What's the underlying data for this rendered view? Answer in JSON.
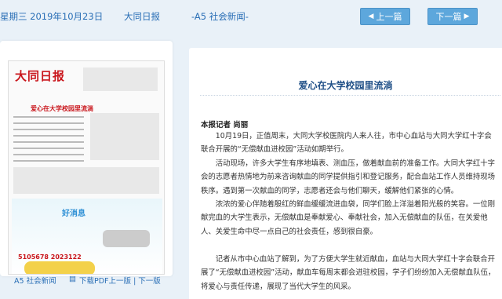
{
  "header": {
    "date": "星期三 2019年10月23日",
    "paper": "大同日报",
    "section": "-A5 社会新闻-",
    "prev_label": "上一篇",
    "next_label": "下一篇"
  },
  "thumbnail": {
    "newspaper_name": "大同日报",
    "headline": "爱心在大学校园里流淌",
    "ad_title": "好消息",
    "phone": "5105678  2023122"
  },
  "footer": {
    "page_label": "A5 社会新闻",
    "pdf_label": "下载PDF",
    "prev_link": "上一版",
    "separator": "|",
    "next_link": "下一版"
  },
  "article": {
    "title": "爱心在大学校园里流淌",
    "author": "本报记者 尚丽",
    "paragraphs": [
      "10月19日，正值周末，大同大学校医院内人来人往，市中心血站与大同大学红十字会联合开展的“无偿献血进校园”活动如期举行。",
      "活动现场，许多大学生有序地填表、测血压，做着献血前的准备工作。大同大学红十字会的志愿者热情地为前来咨询献血的同学提供指引和登记服务，配合血站工作人员维持现场秩序。遇到第一次献血的同学，志愿者还会与他们聊天，缓解他们紧张的心情。",
      "浓浓的爱心伴随着殷红的鲜血缓缓流进血袋，同学们脸上洋溢着阳光般的笑容。一位刚献完血的大学生表示，无偿献血是奉献爱心、奉献社会，加入无偿献血的队伍，在关爱他人、关爱生命中尽一点自己的社会责任，感到很自豪。",
      "记者从市中心血站了解到，为了方便大学生就近献血，血站与大同大学红十字会联合开展了“无偿献血进校园”活动，献血车每周末都会进驻校园，学子们纷纷加入无偿献血队伍，将爱心与责任传递，展现了当代大学生的风采。"
    ]
  },
  "colors": {
    "link": "#2a6fb6",
    "button": "#5da7dc",
    "title": "#1f4f87",
    "page_bg": "#e9f1f8"
  }
}
